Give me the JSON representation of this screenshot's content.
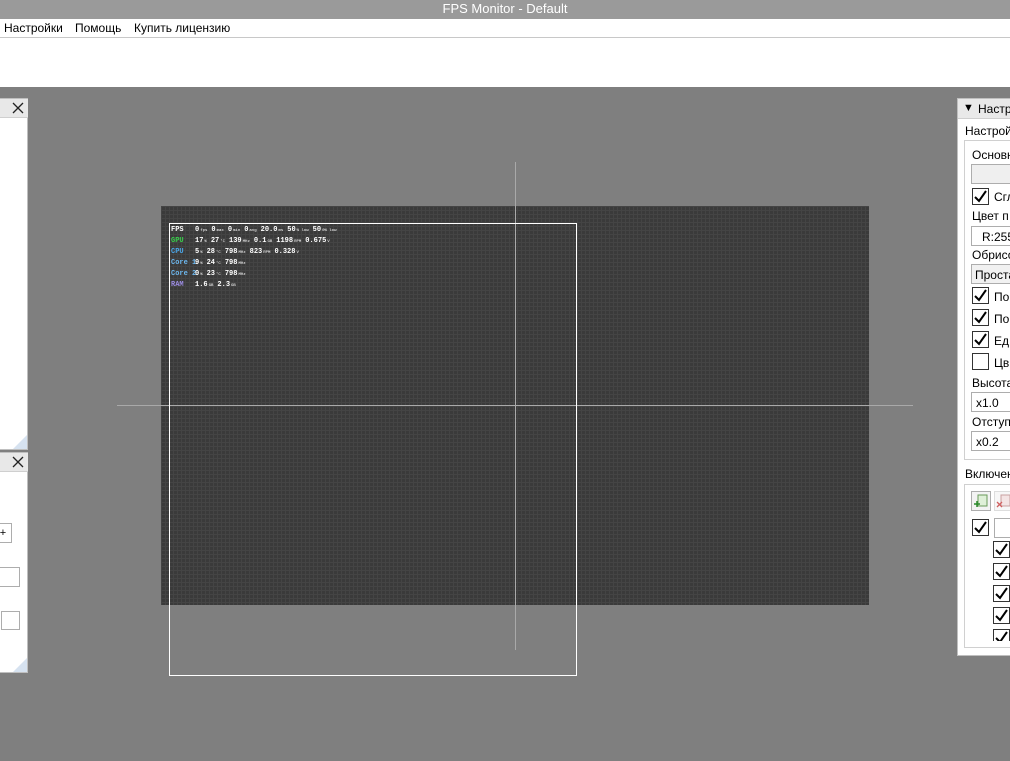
{
  "window": {
    "title": "FPS Monitor - Default"
  },
  "menu": {
    "items": [
      "Настройки",
      "Помощь",
      "Купить лицензию"
    ]
  },
  "osd": {
    "rows": [
      {
        "label": "FPS",
        "color": "#ffffff",
        "cells": [
          [
            "0",
            "fps"
          ],
          [
            "0",
            "max"
          ],
          [
            "0",
            "min"
          ],
          [
            "0",
            "avg"
          ],
          [
            "20.0",
            "ms"
          ],
          [
            "50",
            "% low"
          ],
          [
            "50",
            "0% low"
          ]
        ]
      },
      {
        "label": "GPU",
        "color": "#37d04a",
        "cells": [
          [
            "17",
            "%"
          ],
          [
            "27",
            "°C"
          ],
          [
            "139",
            "MHz"
          ],
          [
            "0.1",
            "GB"
          ],
          [
            "1198",
            "RPM"
          ],
          [
            "0.675",
            "V"
          ]
        ]
      },
      {
        "label": "CPU",
        "color": "#4aa6e8",
        "cells": [
          [
            "5",
            "%"
          ],
          [
            "28",
            "°C"
          ],
          [
            "798",
            "MHz"
          ],
          [
            "823",
            "RPM"
          ],
          [
            "0.328",
            "V"
          ]
        ]
      },
      {
        "label": "Core 1",
        "color": "#6cb7ee",
        "cells": [
          [
            "9",
            "%"
          ],
          [
            "24",
            "°C"
          ],
          [
            "798",
            "MHz"
          ]
        ]
      },
      {
        "label": "Core 2",
        "color": "#6cb7ee",
        "cells": [
          [
            "0",
            "%"
          ],
          [
            "23",
            "°C"
          ],
          [
            "798",
            "MHz"
          ]
        ]
      },
      {
        "label": "RAM",
        "color": "#9a8ae0",
        "cells": [
          [
            "1.6",
            "GB"
          ],
          [
            "2.3",
            "GB"
          ]
        ]
      }
    ]
  },
  "settings": {
    "header": "Настр",
    "section": "Настрой",
    "group_label": "Основн",
    "font_value": "",
    "smooth_label": "Сгл",
    "color_label": "Цвет п",
    "color_value": "R:255",
    "outline_label": "Обрисо",
    "outline_value": "Проста",
    "opt1_label": "По",
    "opt2_label": "По",
    "opt3_label": "Ед",
    "opt4_label": "Цв",
    "height_label": "Высота",
    "height_value": "x1.0",
    "indent_label": "Отступ",
    "indent_value": "x0.2",
    "enabled_label": "Включен"
  },
  "left_panel": {
    "plus": "+"
  }
}
